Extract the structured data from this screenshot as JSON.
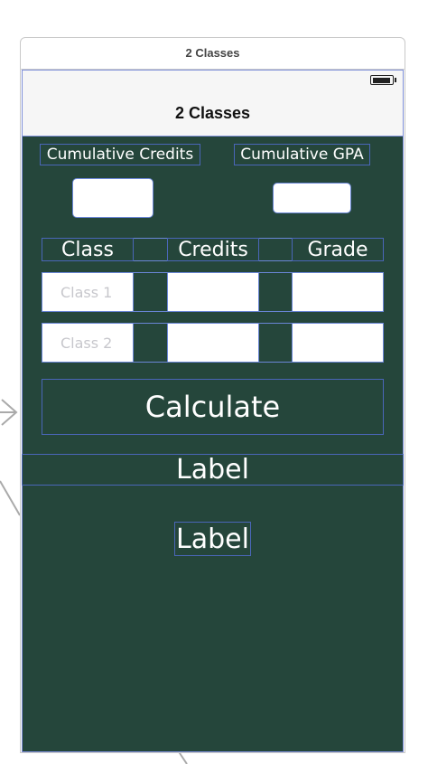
{
  "scene": {
    "title": "2 Classes"
  },
  "nav": {
    "title": "2 Classes"
  },
  "summary": {
    "credits_label": "Cumulative Credits",
    "gpa_label": "Cumulative GPA",
    "credits_value": "",
    "gpa_value": ""
  },
  "table": {
    "headers": [
      "Class",
      "Credits",
      "Grade"
    ],
    "rows": [
      {
        "class_placeholder": "Class 1",
        "credits": "",
        "grade": ""
      },
      {
        "class_placeholder": "Class 2",
        "credits": "",
        "grade": ""
      }
    ]
  },
  "actions": {
    "calculate_label": "Calculate"
  },
  "results": {
    "label_1": "Label",
    "label_2": "Label"
  },
  "colors": {
    "background": "#25463b",
    "frame_outline": "#6a86d6",
    "text": "#ffffff"
  }
}
